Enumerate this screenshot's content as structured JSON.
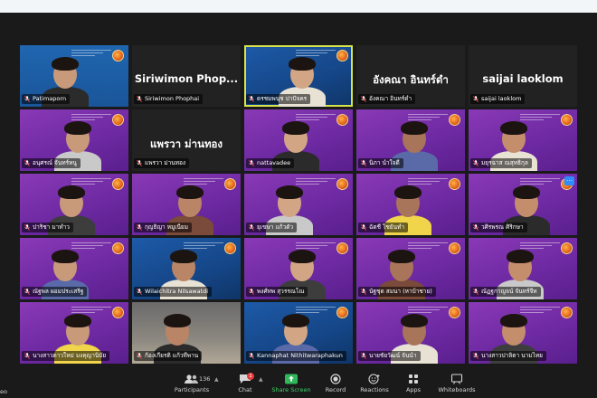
{
  "window": {
    "title": ""
  },
  "colors": {
    "active_speaker": "#d8e24a",
    "tile_purple": "#7a32ac",
    "tile_blue": "#1d5aa8",
    "share_green": "#3ecf6a",
    "badge_red": "#e63b3b"
  },
  "tiles": [
    {
      "name": "Patimaporn",
      "big_name": "",
      "bg": "purple-blue"
    },
    {
      "name": "Siriwimon Phophai",
      "big_name": "Siriwimon  Phop...",
      "bg": "dark"
    },
    {
      "name": "ดรชมพนุช ปาปัจคร",
      "big_name": "",
      "bg": "blue"
    },
    {
      "name": "อังคณา  อินทร์ดำ",
      "big_name": "อังคณา  อินทร์ดำ",
      "bg": "dark"
    },
    {
      "name": "saijai laoklom",
      "big_name": "saijai laoklom",
      "bg": "dark"
    },
    {
      "name": "อนุศรณ์ จันทร์หนู",
      "big_name": "",
      "bg": "purple"
    },
    {
      "name": "แพรวา ม่านทอง",
      "big_name": "แพรวา ม่านทอง",
      "bg": "dark"
    },
    {
      "name": "nattavadee",
      "big_name": "",
      "bg": "purple"
    },
    {
      "name": "นิภา  นำใจดี",
      "big_name": "",
      "bg": "purple"
    },
    {
      "name": "มยุรฉาส ณสุทธิกุล",
      "big_name": "",
      "bg": "purple"
    },
    {
      "name": "ปาริชา มาทำว",
      "big_name": "",
      "bg": "purple"
    },
    {
      "name": "กุญธิญา หมูเนียม",
      "big_name": "",
      "bg": "purple"
    },
    {
      "name": "ยุเขษา แก้วตัว",
      "big_name": "",
      "bg": "purple"
    },
    {
      "name": "ฉัตชี  ไชยันทำ",
      "big_name": "",
      "bg": "purple"
    },
    {
      "name": "วศิรพรณ ศิริกษา",
      "big_name": "",
      "bg": "purple"
    },
    {
      "name": "ณัฐพล ผอมประเสริฐ",
      "big_name": "",
      "bg": "purple"
    },
    {
      "name": "Wilaichitra Nilsawatdi",
      "big_name": "",
      "bg": "blue"
    },
    {
      "name": "พงศ์ทพ สุวรรณโณ",
      "big_name": "",
      "bg": "purple"
    },
    {
      "name": "นัฐชุด สมนา (หาบ้าชาย)",
      "big_name": "",
      "bg": "purple"
    },
    {
      "name": "ณัฏฐกาญจน์ จันทร์จีท",
      "big_name": "",
      "bg": "purple"
    },
    {
      "name": "นางสาวดาวใหม่ มงคุญานิบัย",
      "big_name": "",
      "bg": "purple"
    },
    {
      "name": "ก้องเกียรติ  แก้วทีพาน",
      "big_name": "",
      "bg": "room"
    },
    {
      "name": "Kannaphat Nithitwaraphakun",
      "big_name": "",
      "bg": "blue"
    },
    {
      "name": "นายชัยวัฒน์ จันนำ",
      "big_name": "",
      "bg": "purple"
    },
    {
      "name": "นางสาวปาลิตา นามไทย",
      "big_name": "",
      "bg": "purple"
    }
  ],
  "toolbar": {
    "participants": {
      "label": "Participants",
      "count": "136",
      "icon": "people-icon"
    },
    "chat": {
      "label": "Chat",
      "badge": "1",
      "icon": "chat-icon"
    },
    "share": {
      "label": "Share Screen",
      "icon": "share-screen-icon"
    },
    "record": {
      "label": "Record",
      "icon": "record-icon"
    },
    "reactions": {
      "label": "Reactions",
      "icon": "reactions-icon"
    },
    "apps": {
      "label": "Apps",
      "icon": "apps-icon"
    },
    "whiteboards": {
      "label": "Whiteboards",
      "icon": "whiteboard-icon"
    },
    "left_partial": "eo"
  }
}
